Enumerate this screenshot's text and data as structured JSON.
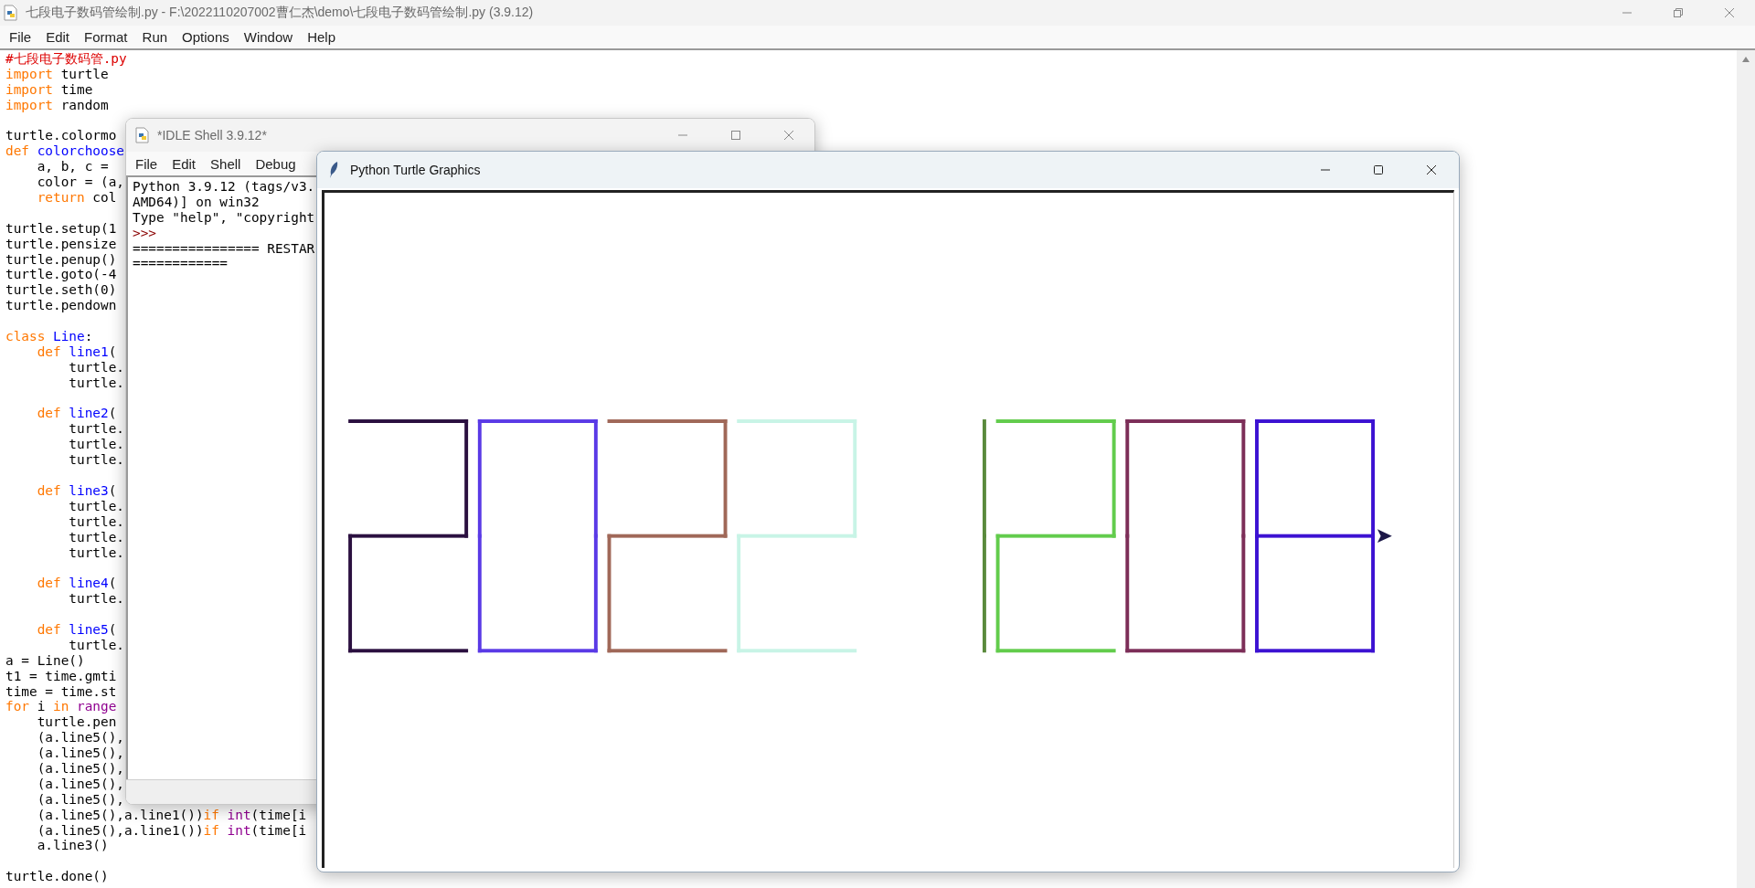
{
  "editor": {
    "title": "七段电子数码管绘制.py - F:\\2022110207002曹仁杰\\demo\\七段电子数码管绘制.py (3.9.12)",
    "menu": [
      "File",
      "Edit",
      "Format",
      "Run",
      "Options",
      "Window",
      "Help"
    ],
    "blocks": [
      {
        "lines": [
          [
            {
              "text": "#七段电子数码管.py",
              "kind": "comment"
            }
          ],
          [
            {
              "text": "import ",
              "kind": "keyword"
            },
            {
              "text": "turtle",
              "kind": "plain"
            }
          ],
          [
            {
              "text": "import ",
              "kind": "keyword"
            },
            {
              "text": "time",
              "kind": "plain"
            }
          ],
          [
            {
              "text": "import ",
              "kind": "keyword"
            },
            {
              "text": "random",
              "kind": "plain"
            }
          ]
        ]
      },
      {
        "lines": [
          [
            {
              "text": "turtle.colormo",
              "kind": "plain"
            }
          ],
          [
            {
              "text": "def ",
              "kind": "keyword"
            },
            {
              "text": "colorchoose",
              "kind": "definition"
            }
          ],
          [
            {
              "text": "    a, b, c =",
              "kind": "plain"
            }
          ],
          [
            {
              "text": "    color = (a,",
              "kind": "plain"
            }
          ],
          [
            {
              "text": "    return ",
              "kind": "keyword"
            },
            {
              "text": "col",
              "kind": "plain"
            }
          ]
        ]
      },
      {
        "lines": [
          [
            {
              "text": "turtle.setup(1",
              "kind": "plain"
            }
          ],
          [
            {
              "text": "turtle.pensize",
              "kind": "plain"
            }
          ],
          [
            {
              "text": "turtle.penup()",
              "kind": "plain"
            }
          ],
          [
            {
              "text": "turtle.goto(-4",
              "kind": "plain"
            }
          ],
          [
            {
              "text": "turtle.seth(0)",
              "kind": "plain"
            }
          ],
          [
            {
              "text": "turtle.pendown",
              "kind": "plain"
            }
          ]
        ]
      },
      {
        "lines": [
          [
            {
              "text": "class ",
              "kind": "keyword"
            },
            {
              "text": "Line",
              "kind": "definition"
            },
            {
              "text": ":",
              "kind": "plain"
            }
          ],
          [
            {
              "text": "    def ",
              "kind": "keyword"
            },
            {
              "text": "line1",
              "kind": "definition"
            },
            {
              "text": "(",
              "kind": "plain"
            }
          ],
          [
            {
              "text": "        turtle.",
              "kind": "plain"
            }
          ],
          [
            {
              "text": "        turtle.",
              "kind": "plain"
            }
          ]
        ]
      },
      {
        "lines": [
          [
            {
              "text": "    def ",
              "kind": "keyword"
            },
            {
              "text": "line2",
              "kind": "definition"
            },
            {
              "text": "(",
              "kind": "plain"
            }
          ],
          [
            {
              "text": "        turtle.",
              "kind": "plain"
            }
          ],
          [
            {
              "text": "        turtle.",
              "kind": "plain"
            }
          ],
          [
            {
              "text": "        turtle.",
              "kind": "plain"
            }
          ]
        ]
      },
      {
        "lines": [
          [
            {
              "text": "    def ",
              "kind": "keyword"
            },
            {
              "text": "line3",
              "kind": "definition"
            },
            {
              "text": "(",
              "kind": "plain"
            }
          ],
          [
            {
              "text": "        turtle.",
              "kind": "plain"
            }
          ],
          [
            {
              "text": "        turtle.",
              "kind": "plain"
            }
          ],
          [
            {
              "text": "        turtle.",
              "kind": "plain"
            }
          ],
          [
            {
              "text": "        turtle.",
              "kind": "plain"
            }
          ]
        ]
      },
      {
        "lines": [
          [
            {
              "text": "    def ",
              "kind": "keyword"
            },
            {
              "text": "line4",
              "kind": "definition"
            },
            {
              "text": "(",
              "kind": "plain"
            }
          ],
          [
            {
              "text": "        turtle.",
              "kind": "plain"
            }
          ]
        ]
      },
      {
        "lines": [
          [
            {
              "text": "    def ",
              "kind": "keyword"
            },
            {
              "text": "line5",
              "kind": "definition"
            },
            {
              "text": "(",
              "kind": "plain"
            }
          ],
          [
            {
              "text": "        turtle.",
              "kind": "plain"
            }
          ],
          [
            {
              "text": "a = Line()",
              "kind": "plain"
            }
          ],
          [
            {
              "text": "t1 = time.gmti",
              "kind": "plain"
            }
          ],
          [
            {
              "text": "time = time.st",
              "kind": "plain"
            }
          ],
          [
            {
              "text": "for ",
              "kind": "keyword"
            },
            {
              "text": "i ",
              "kind": "plain"
            },
            {
              "text": "in ",
              "kind": "keyword"
            },
            {
              "text": "range",
              "kind": "builtin"
            }
          ],
          [
            {
              "text": "    turtle.pen",
              "kind": "plain"
            }
          ],
          [
            {
              "text": "    (a.line5(),",
              "kind": "plain"
            }
          ],
          [
            {
              "text": "    (a.line5(),",
              "kind": "plain"
            }
          ],
          [
            {
              "text": "    (a.line5(),",
              "kind": "plain"
            }
          ],
          [
            {
              "text": "    (a.line5(),",
              "kind": "plain"
            }
          ],
          [
            {
              "text": "    (a.line5(),",
              "kind": "plain"
            }
          ],
          [
            {
              "text": "    (a.line5(),a.line1())",
              "kind": "plain"
            },
            {
              "text": "if ",
              "kind": "keyword"
            },
            {
              "text": "int",
              "kind": "builtin"
            },
            {
              "text": "(time[i",
              "kind": "plain"
            }
          ],
          [
            {
              "text": "    (a.line5(),a.line1())",
              "kind": "plain"
            },
            {
              "text": "if ",
              "kind": "keyword"
            },
            {
              "text": "int",
              "kind": "builtin"
            },
            {
              "text": "(time[i",
              "kind": "plain"
            }
          ],
          [
            {
              "text": "    a.line3()",
              "kind": "plain"
            }
          ]
        ]
      },
      {
        "lines": [
          [
            {
              "text": "turtle.done()",
              "kind": "plain"
            }
          ]
        ]
      }
    ]
  },
  "shell": {
    "title": "*IDLE Shell 3.9.12*",
    "menu": [
      "File",
      "Edit",
      "Shell",
      "Debug"
    ],
    "lines": [
      {
        "text": "Python 3.9.12 (tags/v3.",
        "kind": "output"
      },
      {
        "text": "AMD64)] on win32",
        "kind": "output"
      },
      {
        "text": "Type \"help\", \"copyright",
        "kind": "output"
      },
      {
        "text": ">>>",
        "kind": "prompt"
      },
      {
        "text": "================ RESTAR",
        "kind": "output"
      },
      {
        "text": "============",
        "kind": "output"
      }
    ]
  },
  "turtle": {
    "title": "Python Turtle Graphics",
    "digits": [
      {
        "color": "#2b1040",
        "segments": [
          {
            "kind": "top"
          },
          {
            "kind": "upper_right"
          },
          {
            "kind": "middle"
          },
          {
            "kind": "lower_left"
          },
          {
            "kind": "bottom"
          }
        ]
      },
      {
        "color": "#5a3ae6",
        "segments": [
          {
            "kind": "top"
          },
          {
            "kind": "upper_right"
          },
          {
            "kind": "lower_right"
          },
          {
            "kind": "bottom"
          },
          {
            "kind": "lower_left"
          },
          {
            "kind": "upper_left"
          }
        ]
      },
      {
        "color": "#a06858",
        "segments": [
          {
            "kind": "top"
          },
          {
            "kind": "upper_right"
          },
          {
            "kind": "middle"
          },
          {
            "kind": "lower_left"
          },
          {
            "kind": "bottom"
          }
        ]
      },
      {
        "color": "#c8f4e6",
        "segments": [
          {
            "kind": "top"
          },
          {
            "kind": "upper_right"
          },
          {
            "kind": "middle"
          },
          {
            "kind": "lower_left"
          },
          {
            "kind": "bottom"
          }
        ]
      },
      {
        "color": "#5a8a3c",
        "segments": [
          {
            "kind": "upper_right"
          },
          {
            "kind": "lower_right"
          }
        ]
      },
      {
        "color": "#62cc4c",
        "segments": [
          {
            "kind": "top"
          },
          {
            "kind": "upper_right"
          },
          {
            "kind": "middle"
          },
          {
            "kind": "lower_left"
          },
          {
            "kind": "bottom"
          }
        ]
      },
      {
        "color": "#7c2e58",
        "segments": [
          {
            "kind": "top"
          },
          {
            "kind": "upper_right"
          },
          {
            "kind": "lower_right"
          },
          {
            "kind": "bottom"
          },
          {
            "kind": "lower_left"
          },
          {
            "kind": "upper_left"
          }
        ]
      },
      {
        "color": "#3c12d2",
        "segments": [
          {
            "kind": "top"
          },
          {
            "kind": "upper_right"
          },
          {
            "kind": "lower_right"
          },
          {
            "kind": "bottom"
          },
          {
            "kind": "lower_left"
          },
          {
            "kind": "upper_left"
          },
          {
            "kind": "middle"
          }
        ]
      }
    ]
  }
}
